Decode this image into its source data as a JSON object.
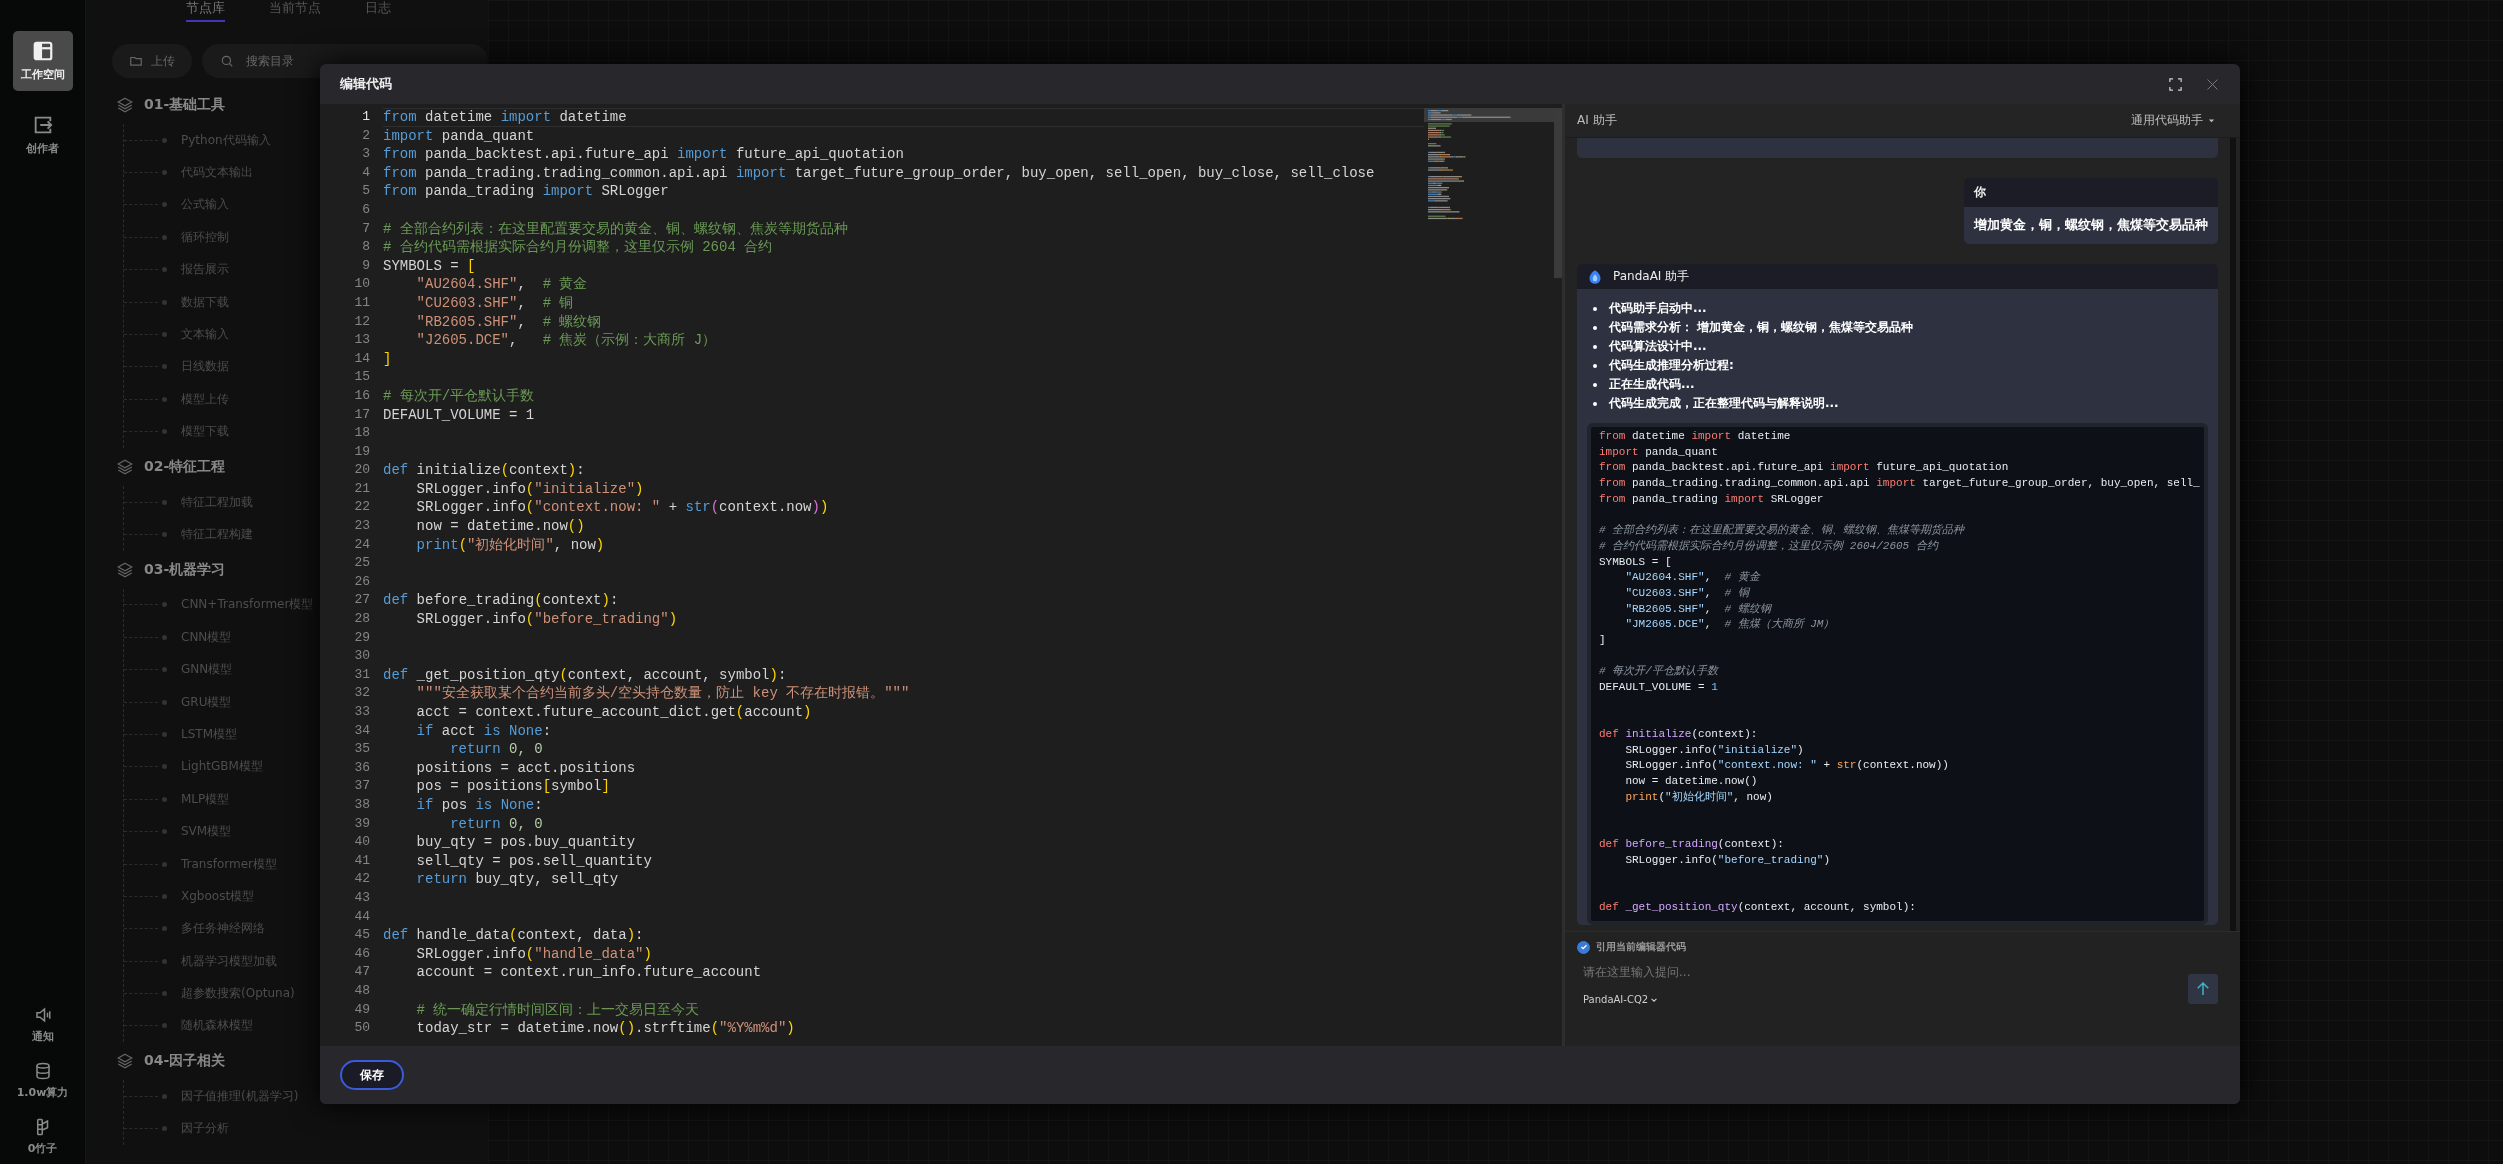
{
  "rail": {
    "items": [
      {
        "label": "工作空间",
        "kind": "layout",
        "selected": true
      },
      {
        "label": "创作者",
        "kind": "exit",
        "selected": false
      }
    ],
    "bottom": [
      {
        "label": "通知",
        "kind": "speaker"
      },
      {
        "label": "1.0w算力",
        "kind": "database"
      },
      {
        "label": "0竹子",
        "kind": "stalk"
      }
    ]
  },
  "node_panel": {
    "tabs": [
      {
        "label": "节点库",
        "selected": true
      },
      {
        "label": "当前节点",
        "selected": false
      },
      {
        "label": "日志",
        "selected": false
      }
    ],
    "upload_button": "上传",
    "search": {
      "placeholder": "搜索目录"
    },
    "groups": [
      {
        "label": "01-基础工具",
        "children": [
          {
            "label": "Python代码输入"
          },
          {
            "label": "代码文本输出"
          },
          {
            "label": "公式输入"
          },
          {
            "label": "循环控制"
          },
          {
            "label": "报告展示"
          },
          {
            "label": "数据下载"
          },
          {
            "label": "文本输入"
          },
          {
            "label": "日线数据"
          },
          {
            "label": "模型上传"
          },
          {
            "label": "模型下载"
          }
        ]
      },
      {
        "label": "02-特征工程",
        "children": [
          {
            "label": "特征工程加载"
          },
          {
            "label": "特征工程构建"
          }
        ]
      },
      {
        "label": "03-机器学习",
        "children": [
          {
            "label": "CNN+Transformer模型"
          },
          {
            "label": "CNN模型"
          },
          {
            "label": "GNN模型"
          },
          {
            "label": "GRU模型"
          },
          {
            "label": "LSTM模型"
          },
          {
            "label": "LightGBM模型"
          },
          {
            "label": "MLP模型"
          },
          {
            "label": "SVM模型"
          },
          {
            "label": "Transformer模型"
          },
          {
            "label": "Xgboost模型"
          },
          {
            "label": "多任务神经网络"
          },
          {
            "label": "机器学习模型加载"
          },
          {
            "label": "超参数搜索(Optuna)"
          },
          {
            "label": "随机森林模型"
          }
        ]
      },
      {
        "label": "04-因子相关",
        "children": [
          {
            "label": "因子值推理(机器学习)"
          },
          {
            "label": "因子分析"
          }
        ]
      }
    ]
  },
  "dialog": {
    "title": "编辑代码",
    "editor": {
      "lines": [
        {
          "n": "1",
          "active": true,
          "tokens": [
            {
              "kind": "kw",
              "text": "from"
            },
            {
              "kind": "tx",
              "text": " datetime "
            },
            {
              "kind": "kw",
              "text": "import"
            },
            {
              "kind": "tx",
              "text": " datetime"
            }
          ]
        },
        {
          "n": "2",
          "active": false,
          "tokens": [
            {
              "kind": "kw",
              "text": "import"
            },
            {
              "kind": "tx",
              "text": " panda_quant"
            }
          ]
        },
        {
          "n": "3",
          "active": false,
          "tokens": [
            {
              "kind": "kw",
              "text": "from"
            },
            {
              "kind": "tx",
              "text": " panda_backtest.api.future_api "
            },
            {
              "kind": "kw",
              "text": "import"
            },
            {
              "kind": "tx",
              "text": " future_api_quotation"
            }
          ]
        },
        {
          "n": "4",
          "active": false,
          "tokens": [
            {
              "kind": "kw",
              "text": "from"
            },
            {
              "kind": "tx",
              "text": " panda_trading.trading_common.api.api "
            },
            {
              "kind": "kw",
              "text": "import"
            },
            {
              "kind": "tx",
              "text": " target_future_group_order, buy_open, sell_open, buy_close, sell_close"
            }
          ]
        },
        {
          "n": "5",
          "active": false,
          "tokens": [
            {
              "kind": "kw",
              "text": "from"
            },
            {
              "kind": "tx",
              "text": " panda_trading "
            },
            {
              "kind": "kw",
              "text": "import"
            },
            {
              "kind": "tx",
              "text": " SRLogger"
            }
          ]
        },
        {
          "n": "6",
          "active": false
        },
        {
          "n": "7",
          "active": false,
          "tokens": [
            {
              "kind": "cm",
              "text": "# 全部合约列表：在这里配置要交易的黄金、铜、螺纹钢、焦炭等期货品种"
            }
          ]
        },
        {
          "n": "8",
          "active": false,
          "tokens": [
            {
              "kind": "cm",
              "text": "# 合约代码需根据实际合约月份调整，这里仅示例 2604 合约"
            }
          ]
        },
        {
          "n": "9",
          "active": false,
          "tokens": [
            {
              "kind": "tx",
              "text": "SYMBOLS = "
            },
            {
              "kind": "br",
              "text": "["
            }
          ]
        },
        {
          "n": "10",
          "active": false,
          "tokens": [
            {
              "kind": "st",
              "text": "    \"AU2604.SHF\""
            },
            {
              "kind": "tx",
              "text": ",  "
            },
            {
              "kind": "cm",
              "text": "# 黄金"
            }
          ]
        },
        {
          "n": "11",
          "active": false,
          "tokens": [
            {
              "kind": "st",
              "text": "    \"CU2603.SHF\""
            },
            {
              "kind": "tx",
              "text": ",  "
            },
            {
              "kind": "cm",
              "text": "# 铜"
            }
          ]
        },
        {
          "n": "12",
          "active": false,
          "tokens": [
            {
              "kind": "st",
              "text": "    \"RB2605.SHF\""
            },
            {
              "kind": "tx",
              "text": ",  "
            },
            {
              "kind": "cm",
              "text": "# 螺纹钢"
            }
          ]
        },
        {
          "n": "13",
          "active": false,
          "tokens": [
            {
              "kind": "st",
              "text": "    \"J2605.DCE\""
            },
            {
              "kind": "tx",
              "text": ",   "
            },
            {
              "kind": "cm",
              "text": "# 焦炭（示例：大商所 J）"
            }
          ]
        },
        {
          "n": "14",
          "active": false,
          "tokens": [
            {
              "kind": "br",
              "text": "]"
            }
          ]
        },
        {
          "n": "15",
          "active": false
        },
        {
          "n": "16",
          "active": false,
          "tokens": [
            {
              "kind": "cm",
              "text": "# 每次开/平仓默认手数"
            }
          ]
        },
        {
          "n": "17",
          "active": false,
          "tokens": [
            {
              "kind": "tx",
              "text": "DEFAULT_VOLUME = 1"
            }
          ]
        },
        {
          "n": "18",
          "active": false
        },
        {
          "n": "19",
          "active": false
        },
        {
          "n": "20",
          "active": false,
          "tokens": [
            {
              "kind": "kw",
              "text": "def"
            },
            {
              "kind": "tx",
              "text": " initialize"
            },
            {
              "kind": "br",
              "text": "("
            },
            {
              "kind": "tx",
              "text": "context"
            },
            {
              "kind": "br",
              "text": ")"
            },
            {
              "kind": "tx",
              "text": ":"
            }
          ]
        },
        {
          "n": "21",
          "active": false,
          "tokens": [
            {
              "kind": "tx",
              "text": "    SRLogger.info"
            },
            {
              "kind": "br",
              "text": "("
            },
            {
              "kind": "st",
              "text": "\"initialize\""
            },
            {
              "kind": "br",
              "text": ")"
            }
          ]
        },
        {
          "n": "22",
          "active": false,
          "tokens": [
            {
              "kind": "tx",
              "text": "    SRLogger.info"
            },
            {
              "kind": "br",
              "text": "("
            },
            {
              "kind": "st",
              "text": "\"context.now: \""
            },
            {
              "kind": "tx",
              "text": " + "
            },
            {
              "kind": "kw",
              "text": "str"
            },
            {
              "kind": "br2",
              "text": "("
            },
            {
              "kind": "tx",
              "text": "context.now"
            },
            {
              "kind": "br2",
              "text": ")"
            },
            {
              "kind": "br",
              "text": ")"
            }
          ]
        },
        {
          "n": "23",
          "active": false,
          "tokens": [
            {
              "kind": "tx",
              "text": "    now = datetime.now"
            },
            {
              "kind": "br",
              "text": "()"
            }
          ]
        },
        {
          "n": "24",
          "active": false,
          "tokens": [
            {
              "kind": "kw",
              "text": "    print"
            },
            {
              "kind": "br",
              "text": "("
            },
            {
              "kind": "st",
              "text": "\"初始化时间\""
            },
            {
              "kind": "tx",
              "text": ", now"
            },
            {
              "kind": "br",
              "text": ")"
            }
          ]
        },
        {
          "n": "25",
          "active": false
        },
        {
          "n": "26",
          "active": false
        },
        {
          "n": "27",
          "active": false,
          "tokens": [
            {
              "kind": "kw",
              "text": "def"
            },
            {
              "kind": "tx",
              "text": " before_trading"
            },
            {
              "kind": "br",
              "text": "("
            },
            {
              "kind": "tx",
              "text": "context"
            },
            {
              "kind": "br",
              "text": ")"
            },
            {
              "kind": "tx",
              "text": ":"
            }
          ]
        },
        {
          "n": "28",
          "active": false,
          "tokens": [
            {
              "kind": "tx",
              "text": "    SRLogger.info"
            },
            {
              "kind": "br",
              "text": "("
            },
            {
              "kind": "st",
              "text": "\"before_trading\""
            },
            {
              "kind": "br",
              "text": ")"
            }
          ]
        },
        {
          "n": "29",
          "active": false
        },
        {
          "n": "30",
          "active": false
        },
        {
          "n": "31",
          "active": false,
          "tokens": [
            {
              "kind": "kw",
              "text": "def"
            },
            {
              "kind": "tx",
              "text": " _get_position_qty"
            },
            {
              "kind": "br",
              "text": "("
            },
            {
              "kind": "tx",
              "text": "context, account, symbol"
            },
            {
              "kind": "br",
              "text": ")"
            },
            {
              "kind": "tx",
              "text": ":"
            }
          ]
        },
        {
          "n": "32",
          "active": false,
          "tokens": [
            {
              "kind": "st",
              "text": "    \"\"\"安全获取某个合约当前多头/空头持仓数量，防止 key 不存在时报错。\"\"\""
            }
          ]
        },
        {
          "n": "33",
          "active": false,
          "tokens": [
            {
              "kind": "tx",
              "text": "    acct = context.future_account_dict.get"
            },
            {
              "kind": "br",
              "text": "("
            },
            {
              "kind": "tx",
              "text": "account"
            },
            {
              "kind": "br",
              "text": ")"
            }
          ]
        },
        {
          "n": "34",
          "active": false,
          "tokens": [
            {
              "kind": "kw",
              "text": "    if"
            },
            {
              "kind": "tx",
              "text": " acct "
            },
            {
              "kind": "kw",
              "text": "is None"
            },
            {
              "kind": "tx",
              "text": ":"
            }
          ]
        },
        {
          "n": "35",
          "active": false,
          "tokens": [
            {
              "kind": "kw",
              "text": "        return"
            },
            {
              "kind": "num",
              "text": " 0, 0"
            }
          ]
        },
        {
          "n": "36",
          "active": false,
          "tokens": [
            {
              "kind": "tx",
              "text": "    positions = acct.positions"
            }
          ]
        },
        {
          "n": "37",
          "active": false,
          "tokens": [
            {
              "kind": "tx",
              "text": "    pos = positions"
            },
            {
              "kind": "br",
              "text": "["
            },
            {
              "kind": "tx",
              "text": "symbol"
            },
            {
              "kind": "br",
              "text": "]"
            }
          ]
        },
        {
          "n": "38",
          "active": false,
          "tokens": [
            {
              "kind": "kw",
              "text": "    if"
            },
            {
              "kind": "tx",
              "text": " pos "
            },
            {
              "kind": "kw",
              "text": "is None"
            },
            {
              "kind": "tx",
              "text": ":"
            }
          ]
        },
        {
          "n": "39",
          "active": false,
          "tokens": [
            {
              "kind": "kw",
              "text": "        return"
            },
            {
              "kind": "num",
              "text": " 0, 0"
            }
          ]
        },
        {
          "n": "40",
          "active": false,
          "tokens": [
            {
              "kind": "tx",
              "text": "    buy_qty = pos.buy_quantity"
            }
          ]
        },
        {
          "n": "41",
          "active": false,
          "tokens": [
            {
              "kind": "tx",
              "text": "    sell_qty = pos.sell_quantity"
            }
          ]
        },
        {
          "n": "42",
          "active": false,
          "tokens": [
            {
              "kind": "kw",
              "text": "    return"
            },
            {
              "kind": "tx",
              "text": " buy_qty, sell_qty"
            }
          ]
        },
        {
          "n": "43",
          "active": false
        },
        {
          "n": "44",
          "active": false
        },
        {
          "n": "45",
          "active": false,
          "tokens": [
            {
              "kind": "kw",
              "text": "def"
            },
            {
              "kind": "tx",
              "text": " handle_data"
            },
            {
              "kind": "br",
              "text": "("
            },
            {
              "kind": "tx",
              "text": "context, data"
            },
            {
              "kind": "br",
              "text": ")"
            },
            {
              "kind": "tx",
              "text": ":"
            }
          ]
        },
        {
          "n": "46",
          "active": false,
          "tokens": [
            {
              "kind": "tx",
              "text": "    SRLogger.info"
            },
            {
              "kind": "br",
              "text": "("
            },
            {
              "kind": "st",
              "text": "\"handle_data\""
            },
            {
              "kind": "br",
              "text": ")"
            }
          ]
        },
        {
          "n": "47",
          "active": false,
          "tokens": [
            {
              "kind": "tx",
              "text": "    account = context.run_info.future_account"
            }
          ]
        },
        {
          "n": "48",
          "active": false
        },
        {
          "n": "49",
          "active": false,
          "tokens": [
            {
              "kind": "cm",
              "text": "    # 统一确定行情时间区间：上一交易日至今天"
            }
          ]
        },
        {
          "n": "50",
          "active": false,
          "tokens": [
            {
              "kind": "tx",
              "text": "    today_str = datetime.now"
            },
            {
              "kind": "br",
              "text": "()"
            },
            {
              "kind": "tx",
              "text": ".strftime"
            },
            {
              "kind": "br",
              "text": "("
            },
            {
              "kind": "st",
              "text": "\"%Y%m%d\""
            },
            {
              "kind": "br",
              "text": ")"
            }
          ]
        }
      ]
    },
    "ai": {
      "title": "AI 助手",
      "mode": "通用代码助手",
      "messages": [
        {
          "kind": "user",
          "author": "你",
          "text": "增加黄金，铜，螺纹钢，焦煤等交易品种"
        },
        {
          "kind": "assistant",
          "author": "PandaAI 助手",
          "steps": [
            "代码助手启动中...",
            "代码需求分析： 增加黄金，铜，螺纹钢，焦煤等交易品种",
            "代码算法设计中...",
            "代码生成推理分析过程:",
            "正在生成代码...",
            "代码生成完成，正在整理代码与解释说明..."
          ],
          "code": [
            {
              "tokens": [
                {
                  "kind": "kw",
                  "text": "from"
                },
                {
                  "kind": "tx",
                  "text": " datetime "
                },
                {
                  "kind": "kw",
                  "text": "import"
                },
                {
                  "kind": "tx",
                  "text": " datetime"
                }
              ]
            },
            {
              "tokens": [
                {
                  "kind": "kw",
                  "text": "import"
                },
                {
                  "kind": "tx",
                  "text": " panda_quant"
                }
              ]
            },
            {
              "tokens": [
                {
                  "kind": "kw",
                  "text": "from"
                },
                {
                  "kind": "tx",
                  "text": " panda_backtest.api.future_api "
                },
                {
                  "kind": "kw",
                  "text": "import"
                },
                {
                  "kind": "tx",
                  "text": " future_api_quotation"
                }
              ]
            },
            {
              "tokens": [
                {
                  "kind": "kw",
                  "text": "from"
                },
                {
                  "kind": "tx",
                  "text": " panda_trading.trading_common.api.api "
                },
                {
                  "kind": "kw",
                  "text": "import"
                },
                {
                  "kind": "tx",
                  "text": " target_future_group_order, buy_open, sell_"
                }
              ]
            },
            {
              "tokens": [
                {
                  "kind": "kw",
                  "text": "from"
                },
                {
                  "kind": "tx",
                  "text": " panda_trading "
                },
                {
                  "kind": "kw",
                  "text": "import"
                },
                {
                  "kind": "tx",
                  "text": " SRLogger"
                }
              ]
            },
            {
              "blank": true
            },
            {
              "tokens": [
                {
                  "kind": "cm",
                  "text": "# 全部合约列表：在这里配置要交易的黄金、铜、螺纹钢、焦煤等期货品种"
                }
              ]
            },
            {
              "tokens": [
                {
                  "kind": "cm",
                  "text": "# 合约代码需根据实际合约月份调整，这里仅示例 2604/2605 合约"
                }
              ]
            },
            {
              "tokens": [
                {
                  "kind": "tx",
                  "text": "SYMBOLS = ["
                }
              ]
            },
            {
              "tokens": [
                {
                  "kind": "st",
                  "text": "    \"AU2604.SHF\""
                },
                {
                  "kind": "tx",
                  "text": ",  "
                },
                {
                  "kind": "cm",
                  "text": "# 黄金"
                }
              ]
            },
            {
              "tokens": [
                {
                  "kind": "st",
                  "text": "    \"CU2603.SHF\""
                },
                {
                  "kind": "tx",
                  "text": ",  "
                },
                {
                  "kind": "cm",
                  "text": "# 铜"
                }
              ]
            },
            {
              "tokens": [
                {
                  "kind": "st",
                  "text": "    \"RB2605.SHF\""
                },
                {
                  "kind": "tx",
                  "text": ",  "
                },
                {
                  "kind": "cm",
                  "text": "# 螺纹钢"
                }
              ]
            },
            {
              "tokens": [
                {
                  "kind": "st",
                  "text": "    \"JM2605.DCE\""
                },
                {
                  "kind": "tx",
                  "text": ",  "
                },
                {
                  "kind": "cm",
                  "text": "# 焦煤（大商所 JM）"
                }
              ]
            },
            {
              "tokens": [
                {
                  "kind": "tx",
                  "text": "]"
                }
              ]
            },
            {
              "blank": true
            },
            {
              "tokens": [
                {
                  "kind": "cm",
                  "text": "# 每次开/平仓默认手数"
                }
              ]
            },
            {
              "tokens": [
                {
                  "kind": "tx",
                  "text": "DEFAULT_VOLUME = "
                },
                {
                  "kind": "num",
                  "text": "1"
                }
              ]
            },
            {
              "blank": true
            },
            {
              "blank": true
            },
            {
              "tokens": [
                {
                  "kind": "kw",
                  "text": "def"
                },
                {
                  "kind": "fn",
                  "text": " initialize"
                },
                {
                  "kind": "tx",
                  "text": "(context):"
                }
              ]
            },
            {
              "tokens": [
                {
                  "kind": "tx",
                  "text": "    SRLogger.info("
                },
                {
                  "kind": "st",
                  "text": "\"initialize\""
                },
                {
                  "kind": "tx",
                  "text": ")"
                }
              ]
            },
            {
              "tokens": [
                {
                  "kind": "tx",
                  "text": "    SRLogger.info("
                },
                {
                  "kind": "st",
                  "text": "\"context.now: \""
                },
                {
                  "kind": "tx",
                  "text": " + "
                },
                {
                  "kind": "bi",
                  "text": "str"
                },
                {
                  "kind": "tx",
                  "text": "(context.now))"
                }
              ]
            },
            {
              "tokens": [
                {
                  "kind": "tx",
                  "text": "    now = datetime.now()"
                }
              ]
            },
            {
              "tokens": [
                {
                  "kind": "bi",
                  "text": "    print"
                },
                {
                  "kind": "tx",
                  "text": "("
                },
                {
                  "kind": "st",
                  "text": "\"初始化时间\""
                },
                {
                  "kind": "tx",
                  "text": ", now)"
                }
              ]
            },
            {
              "blank": true
            },
            {
              "blank": true
            },
            {
              "tokens": [
                {
                  "kind": "kw",
                  "text": "def"
                },
                {
                  "kind": "fn",
                  "text": " before_trading"
                },
                {
                  "kind": "tx",
                  "text": "(context):"
                }
              ]
            },
            {
              "tokens": [
                {
                  "kind": "tx",
                  "text": "    SRLogger.info("
                },
                {
                  "kind": "st",
                  "text": "\"before_trading\""
                },
                {
                  "kind": "tx",
                  "text": ")"
                }
              ]
            },
            {
              "blank": true
            },
            {
              "blank": true
            },
            {
              "tokens": [
                {
                  "kind": "kw",
                  "text": "def"
                },
                {
                  "kind": "fn",
                  "text": " _get_position_qty"
                },
                {
                  "kind": "tx",
                  "text": "(context, account, symbol):"
                }
              ]
            }
          ]
        }
      ],
      "quote": {
        "label": "引用当前编辑器代码",
        "checked": true
      },
      "input": {
        "placeholder": "请在这里输入提问..."
      },
      "model": "PandaAI-CQ2"
    },
    "save_button": "保存"
  }
}
